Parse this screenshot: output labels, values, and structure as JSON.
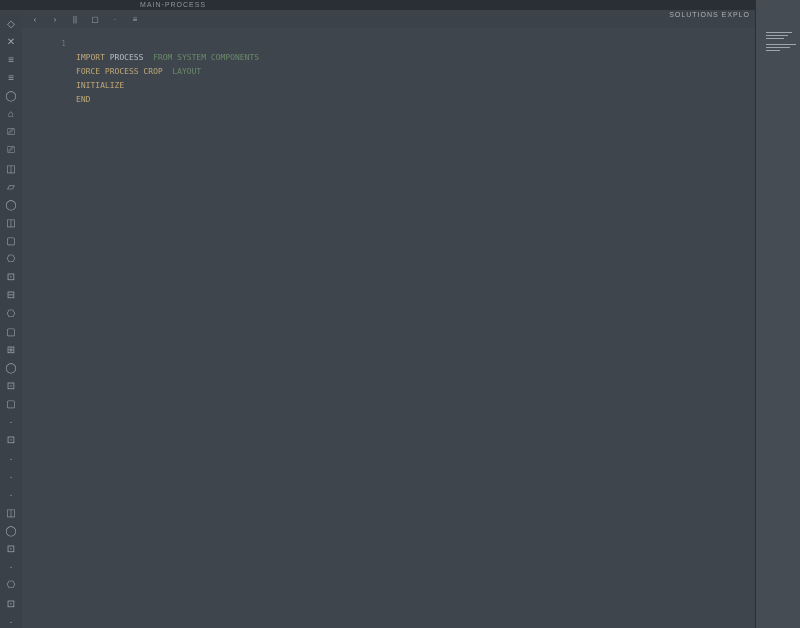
{
  "titlebar": {
    "filename": "MAIN-PROCESS"
  },
  "rightheader": {
    "label": "SOLUTIONS EXPLO"
  },
  "sidebar": {
    "icons": [
      "◇",
      "✕",
      "≡",
      "≡",
      "◯",
      "⌂",
      "⎚",
      "⎚",
      "◫",
      "▱",
      "◯",
      "◫",
      "▢",
      "⎔",
      "⊡",
      "⊟",
      "⎔",
      "▢",
      "⊞",
      "◯",
      "⊡",
      "▢",
      "·",
      "⊡",
      "·",
      "·",
      "·",
      "◫",
      "◯",
      "⊡",
      "·",
      "⎔",
      "⊡",
      "·"
    ]
  },
  "toolbar": {
    "items": [
      "‹",
      "›",
      "||",
      "▢",
      "·",
      "≡"
    ]
  },
  "editor": {
    "lines": [
      {
        "n": "1",
        "indent": "",
        "a": "",
        "b": "",
        "c": ""
      },
      {
        "n": "",
        "indent": "",
        "a": "IMPORT ",
        "b": "PROCESS",
        "c": " FROM SYSTEM COMPONENTS"
      },
      {
        "n": "",
        "indent": "",
        "a": "FORCE PROCESS CROP ",
        "b": "",
        "c": "LAYOUT"
      },
      {
        "n": "",
        "indent": "",
        "a": "INITIALIZE",
        "b": "",
        "c": ""
      },
      {
        "n": "",
        "indent": "",
        "a": "END",
        "b": "",
        "c": ""
      }
    ]
  }
}
